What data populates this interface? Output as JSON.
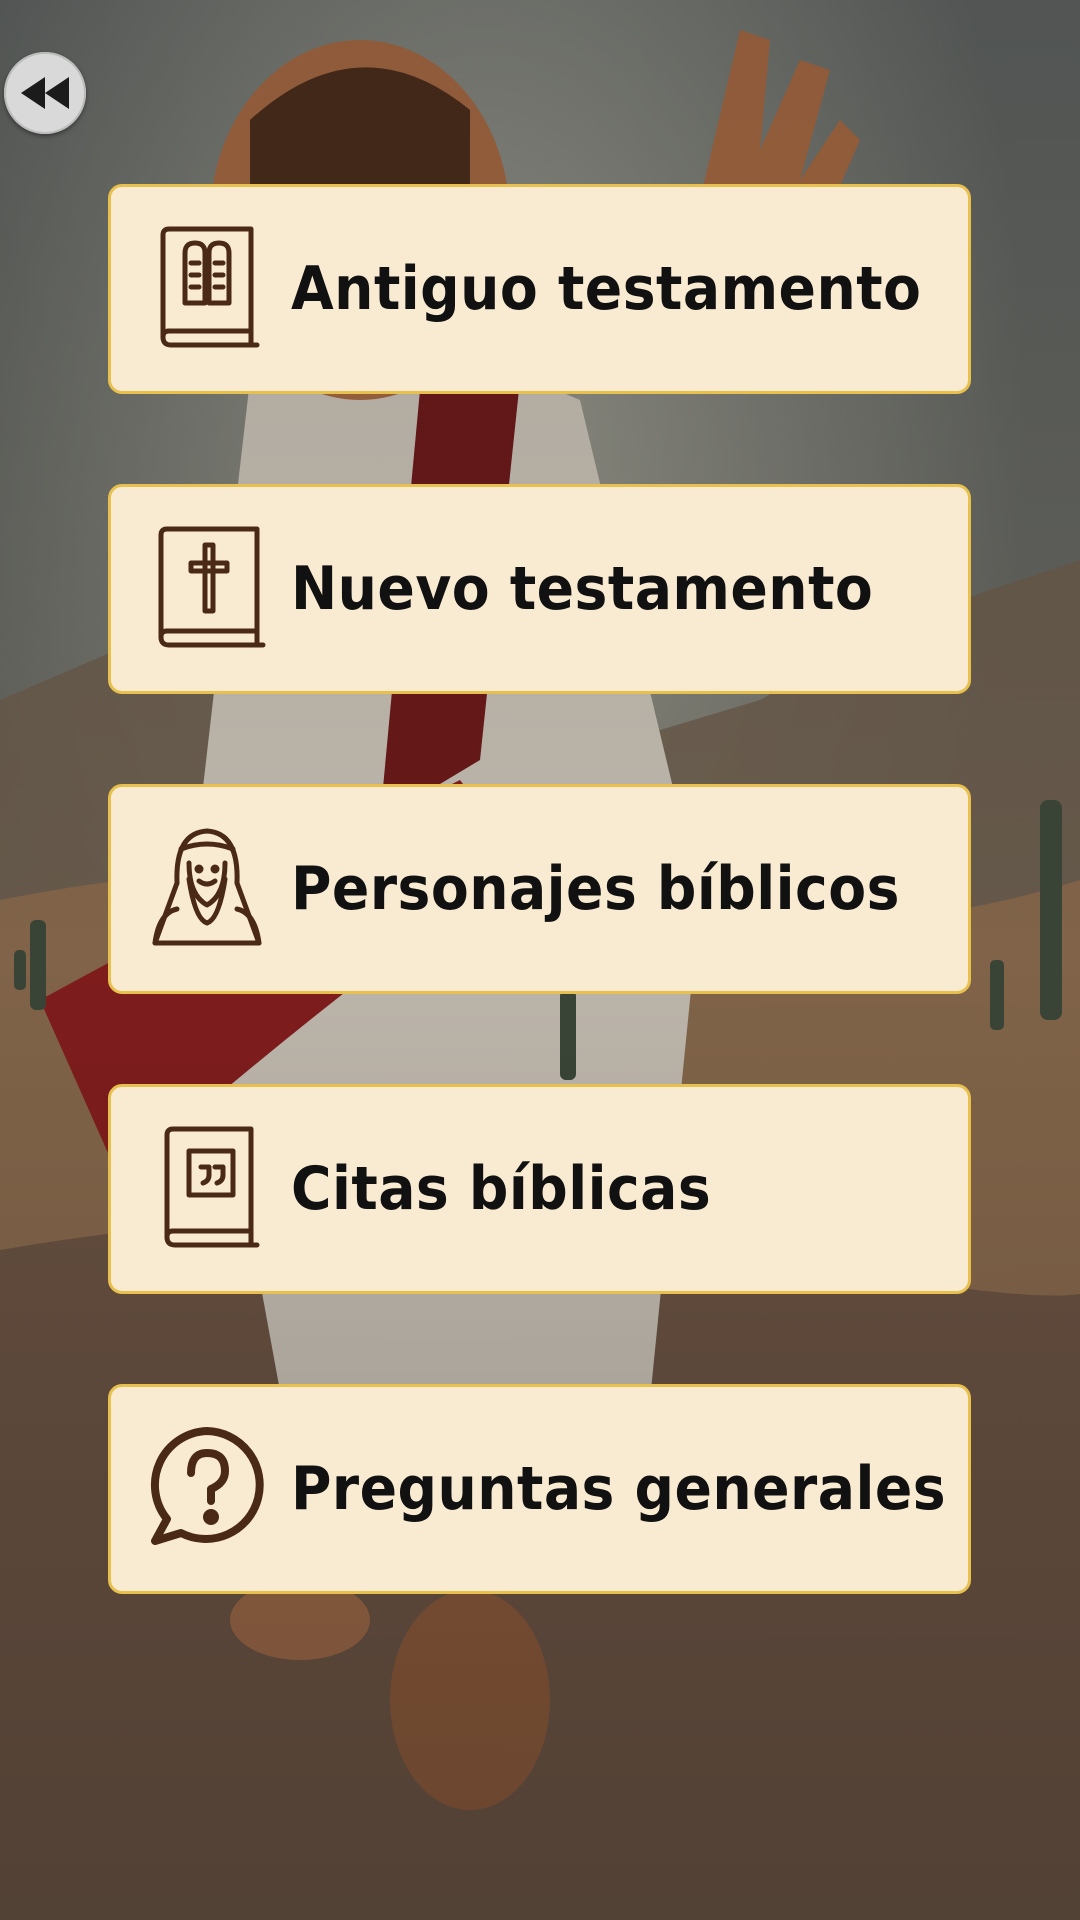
{
  "back_button": {
    "icon": "rewind-icon"
  },
  "menu": {
    "items": [
      {
        "label": "Antiguo testamento",
        "icon": "tablets-book-icon"
      },
      {
        "label": "Nuevo testamento",
        "icon": "cross-book-icon"
      },
      {
        "label": "Personajes bíblicos",
        "icon": "prophet-icon"
      },
      {
        "label": "Citas bíblicas",
        "icon": "quote-book-icon"
      },
      {
        "label": "Preguntas generales",
        "icon": "question-bubble-icon"
      }
    ]
  },
  "colors": {
    "card_background": "#f9ead2",
    "card_border": "#e7c04e",
    "icon_stroke": "#4a2a17",
    "text": "#111111"
  }
}
